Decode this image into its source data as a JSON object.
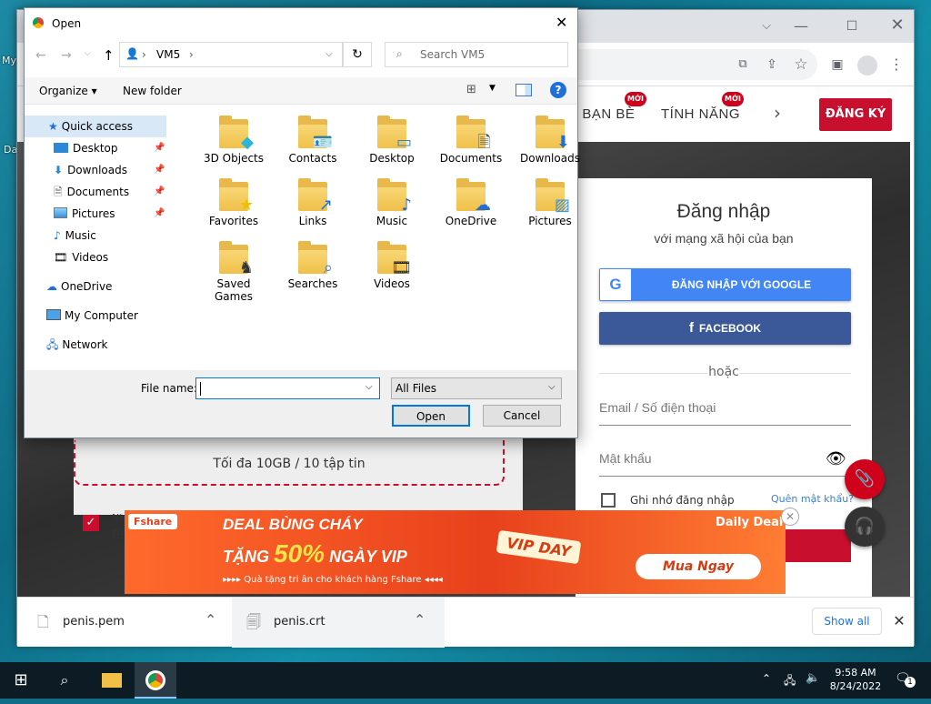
{
  "desktop": {
    "labels": [
      "My",
      "Da"
    ]
  },
  "chrome": {
    "toolbar_icons": [
      "translate-icon",
      "share-icon",
      "star-icon",
      "side-panel-icon",
      "profile-icon",
      "menu-icon"
    ],
    "nav": {
      "item1": "I BẠN BÈ",
      "item2": "TÍNH NĂNG",
      "badge": "MỚI",
      "register": "ĐĂNG KÝ"
    },
    "login": {
      "title": "Đăng nhập",
      "subtitle": "với mạng xã hội của bạn",
      "google": "ĐĂNG NHẬP VỚI GOOGLE",
      "facebook": "FACEBOOK",
      "or": "hoặc",
      "email_placeholder": "Email / Số điện thoại",
      "password_placeholder": "Mật khẩu",
      "remember": "Ghi nhớ đăng nhập",
      "forgot": "Quên mật khẩu?"
    },
    "upload": {
      "limit": "Tối đa 10GB / 10 tập tin",
      "frag1": "Nh",
      "frag2": "Đi"
    },
    "banner": {
      "brand": "Fshare",
      "headline": "DEAL BÙNG CHÁY",
      "offer_prefix": "TẶNG",
      "offer_value": "50%",
      "offer_suffix": "NGÀY VIP",
      "tagline": "▸▸▸▸ Quà tặng tri ân cho khách hàng Fshare ◂◂◂◂",
      "daily": "Daily Deal",
      "vip": "VIP DAY",
      "cta": "Mua Ngay"
    },
    "downloads": {
      "items": [
        {
          "name": "penis.pem"
        },
        {
          "name": "penis.crt"
        }
      ],
      "show_all": "Show all"
    }
  },
  "dialog": {
    "title": "Open",
    "address": {
      "segment": "VM5"
    },
    "search_placeholder": "Search VM5",
    "commands": {
      "organize": "Organize",
      "new_folder": "New folder"
    },
    "nav": {
      "quick_access": "Quick access",
      "desktop": "Desktop",
      "downloads": "Downloads",
      "documents": "Documents",
      "pictures": "Pictures",
      "music": "Music",
      "videos": "Videos",
      "onedrive": "OneDrive",
      "computer": "My Computer",
      "network": "Network"
    },
    "folders": [
      {
        "name": "3D Objects",
        "icon": "cube-icon"
      },
      {
        "name": "Contacts",
        "icon": "contact-card-icon"
      },
      {
        "name": "Desktop",
        "icon": "monitor-icon"
      },
      {
        "name": "Documents",
        "icon": "document-icon"
      },
      {
        "name": "Downloads",
        "icon": "download-arrow-icon"
      },
      {
        "name": "Favorites",
        "icon": "star-icon"
      },
      {
        "name": "Links",
        "icon": "link-arrow-icon"
      },
      {
        "name": "Music",
        "icon": "music-note-icon"
      },
      {
        "name": "OneDrive",
        "icon": "cloud-icon"
      },
      {
        "name": "Pictures",
        "icon": "picture-icon"
      },
      {
        "name": "Saved Games",
        "icon": "chess-piece-icon"
      },
      {
        "name": "Searches",
        "icon": "magnifier-icon"
      },
      {
        "name": "Videos",
        "icon": "film-icon"
      }
    ],
    "filename_label": "File name:",
    "filename_value": "",
    "filter": "All Files",
    "open": "Open",
    "cancel": "Cancel"
  },
  "taskbar": {
    "time": "9:58 AM",
    "date": "8/24/2022",
    "notifications": "1"
  }
}
